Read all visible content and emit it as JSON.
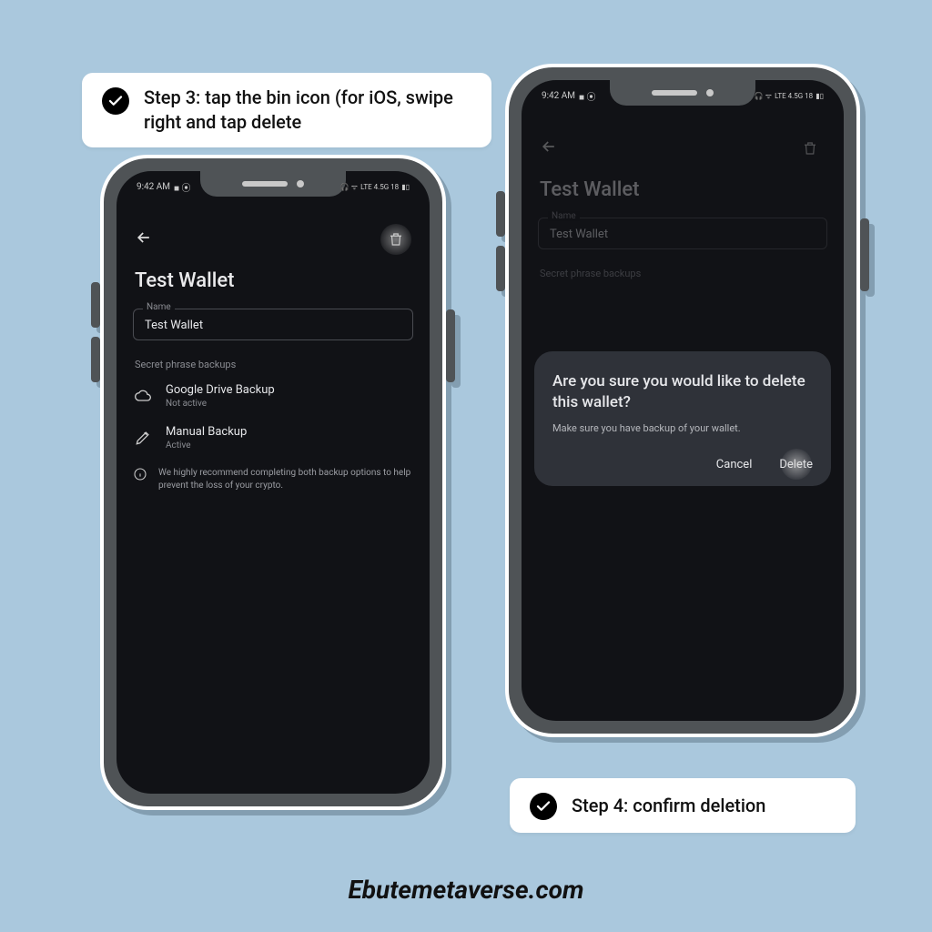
{
  "callouts": {
    "step3": "Step 3: tap the bin icon (for iOS, swipe right and tap delete",
    "step4": "Step 4: confirm deletion"
  },
  "status": {
    "time": "9:42 AM",
    "right_indicators": "LTE 4.5G 18"
  },
  "wallet": {
    "title": "Test Wallet",
    "name_label": "Name",
    "name_value": "Test Wallet",
    "backups_section": "Secret phrase backups",
    "google_drive": {
      "title": "Google Drive Backup",
      "sub": "Not active"
    },
    "manual": {
      "title": "Manual Backup",
      "sub": "Active"
    },
    "info": "We highly recommend completing both backup options to help prevent the loss of your crypto."
  },
  "dialog": {
    "title": "Are you sure you would like to delete this wallet?",
    "message": "Make sure you have backup of your wallet.",
    "cancel": "Cancel",
    "delete": "Delete"
  },
  "footer": "Ebutemetaverse.com"
}
